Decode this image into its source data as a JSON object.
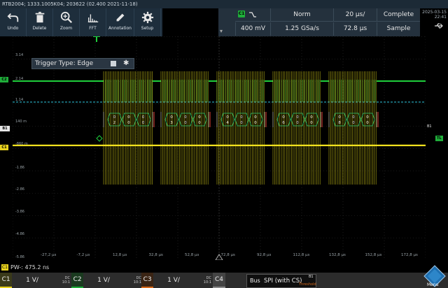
{
  "title_bar": "RTB2004; 1333.1005K04; 203622 (02.400 2021-11-18)",
  "toolbar": {
    "undo": "Undo",
    "delete": "Delete",
    "zoom": "Zoom",
    "fft": "FFT",
    "annotation": "Annotation",
    "setup": "Setup"
  },
  "acquisition": {
    "channel_badge": "C1",
    "trigger_mode": "Norm",
    "time_scale": "20 µs/",
    "state": "Complete",
    "voltage": "400 mV",
    "sample_rate": "1.25 GSa/s",
    "time_position": "72.8 µs",
    "acq_mode": "Sample"
  },
  "datetime": {
    "date": "2025-03-15",
    "time": "22:41"
  },
  "trigger_box": {
    "label": "Trigger Type: Edge"
  },
  "y_labels": [
    "3.14",
    "2.14",
    "1.14",
    "140 m",
    "-860 m",
    "-1.86",
    "-2.86",
    "-3.86",
    "-4.86",
    "-5.86"
  ],
  "x_labels": [
    "-27,2 µs",
    "-7,2 µs",
    "12,8 µs",
    "32,8 µs",
    "52,8 µs",
    "72,8 µs",
    "92,8 µs",
    "112,8 µs",
    "132,8 µs",
    "152,8 µs",
    "172,8 µs"
  ],
  "left_markers": {
    "c2": "C2",
    "b1": "B1",
    "c1": "C1"
  },
  "right_markers": {
    "b1": "B1",
    "tl": "TL"
  },
  "bus_decode": [
    [
      "0",
      "0",
      "2",
      "0"
    ],
    [
      "0",
      "0",
      "3",
      "0"
    ],
    [
      "0",
      "0",
      "4",
      "0"
    ],
    [
      "0",
      "0",
      "6",
      "0"
    ],
    [
      "0",
      "0",
      "8",
      "0"
    ]
  ],
  "measurement": {
    "badge": "C1",
    "text": "PW-: 475.2 ns"
  },
  "channels": [
    {
      "name": "C1",
      "scale": "1 V/",
      "coupling": "DC",
      "probe": "10:1",
      "color": "#e8d21e"
    },
    {
      "name": "C2",
      "scale": "1 V/",
      "coupling": "DC",
      "probe": "10:1",
      "color": "#1fae3a"
    },
    {
      "name": "C3",
      "scale": "1 V/",
      "coupling": "DC",
      "probe": "10:1",
      "color": "#d86a1c"
    },
    {
      "name": "C4",
      "scale": "",
      "coupling": "",
      "probe": "",
      "color": "#8a8a8a"
    }
  ],
  "bus": {
    "label": "Bus",
    "name": "SPI (with CS)",
    "tag": "B1",
    "threshold": "Threshold"
  },
  "menu": {
    "label": "Menu"
  },
  "colors": {
    "ch1": "#e8d21e",
    "ch2": "#1fae3a",
    "ch3": "#d86a1c",
    "bus": "#2fc9e0",
    "background": "#000000"
  }
}
